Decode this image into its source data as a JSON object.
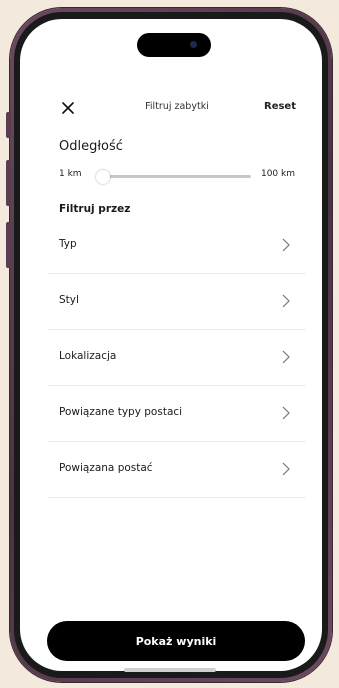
{
  "header": {
    "title": "Filtruj zabytki",
    "reset_label": "Reset"
  },
  "distance": {
    "heading": "Odległość",
    "min_label": "1 km",
    "max_label": "100 km",
    "value_fraction": 0.0
  },
  "filter": {
    "heading": "Filtruj przez",
    "items": [
      {
        "label": "Typ"
      },
      {
        "label": "Styl"
      },
      {
        "label": "Lokalizacja"
      },
      {
        "label": "Powiązane typy postaci"
      },
      {
        "label": "Powiązana postać"
      }
    ]
  },
  "cta": {
    "label": "Pokaż wyniki"
  },
  "icons": {
    "close": "close-icon",
    "chevron": "chevron-right-icon"
  }
}
